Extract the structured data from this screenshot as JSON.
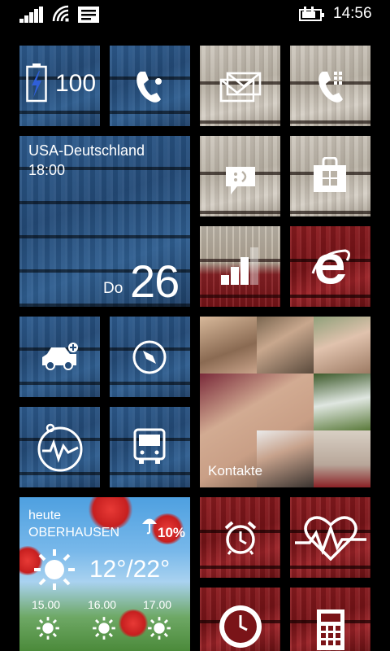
{
  "status_bar": {
    "time": "14:56",
    "icons": [
      "signal-strength-icon",
      "wifi-icon",
      "message-icon",
      "charging-icon"
    ]
  },
  "tiles": {
    "battery": {
      "value": "100",
      "icon": "battery-charging-icon"
    },
    "phone_missed": {
      "icon": "phone-icon"
    },
    "messaging": {
      "icon": "mail-icon"
    },
    "phone_dialer": {
      "icon": "phone-icon"
    },
    "calendar": {
      "title": "USA-Deutschland",
      "time": "18:00",
      "weekday": "Do",
      "date": "26"
    },
    "chat": {
      "icon": "chat-icon"
    },
    "store": {
      "icon": "store-icon"
    },
    "data_sense": {
      "icon": "signal-bars-icon"
    },
    "internet_explorer": {
      "icon": "internet-explorer-icon"
    },
    "people": {
      "label": "Kontakte"
    },
    "car": {
      "icon": "car-add-icon"
    },
    "compass": {
      "icon": "compass-icon"
    },
    "health": {
      "icon": "health-monitor-icon"
    },
    "transit": {
      "icon": "bus-icon"
    },
    "alarm": {
      "icon": "alarm-clock-icon"
    },
    "heart": {
      "icon": "heart-rate-icon"
    },
    "clock": {
      "icon": "clock-icon"
    },
    "calculator": {
      "icon": "calculator-icon"
    }
  },
  "weather": {
    "today_label": "heute",
    "city": "OBERHAUSEN",
    "precip": "10%",
    "temp": "12°/22°",
    "hourly": [
      "15.00",
      "16.00",
      "17.00"
    ],
    "icons": [
      "umbrella-icon",
      "sun-icon"
    ]
  },
  "colors": {
    "blue_wood": "#2d5b8e",
    "white_wood": "#cfc9bf",
    "red_wood": "#8e1c20",
    "background": "#000000"
  }
}
